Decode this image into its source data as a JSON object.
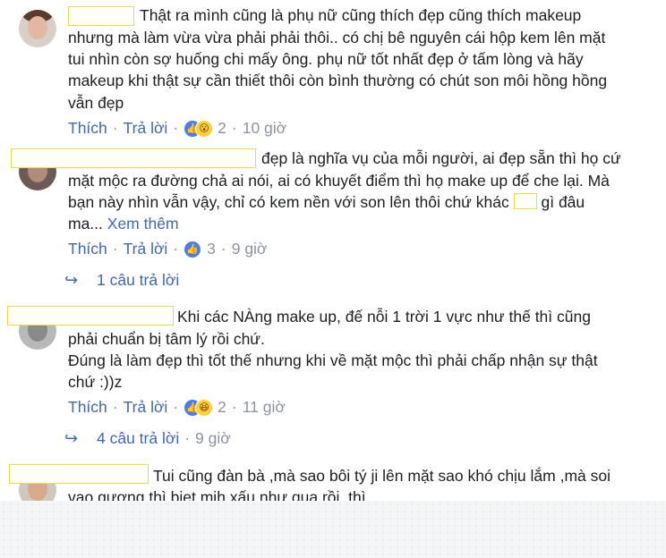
{
  "comments": [
    {
      "lines": [
        "Thật ra mình cũng là phụ nữ cũng thích đẹp cũng thích makeup",
        "nhưng mà làm vừa vừa phải phải thôi.. có chị bê nguyên cái hộp kem lên mặt",
        "tui nhìn còn sợ huống chi mấy ông. phụ nữ tốt nhất đẹp ở tấm lòng và hãy",
        "makeup khi thật sự cần thiết thôi còn bình thường có chút son môi hồng hồng",
        "vẫn đẹp"
      ],
      "like_label": "Thích",
      "reply_label": "Trả lời",
      "reaction_count": "2",
      "time": "10 giờ"
    },
    {
      "lines": [
        "đẹp là nghĩa vụ của mỗi người, ai đẹp sẵn thì họ cứ",
        "mặt mộc ra đường chả ai nói, ai có khuyết điểm thì họ make up để che lại. Mà",
        "bạn này nhìn vẫn vậy, chỉ có kem nền với son lên thôi chứ khác",
        "gì đâu",
        "ma...",
        "Xem thêm"
      ],
      "like_label": "Thích",
      "reply_label": "Trả lời",
      "reaction_count": "3",
      "time": "9 giờ",
      "replies": "1 câu trả lời"
    },
    {
      "lines": [
        "Khi các NÀng make up, đế nỗi 1 trời 1 vực như thế thì cũng",
        "phải chuẩn bị tâm lý rồi chứ.",
        "Đúng là làm đẹp thì tốt thế nhưng khi về mặt mộc thì phải chấp nhận sự thật",
        "chứ :))z"
      ],
      "like_label": "Thích",
      "reply_label": "Trả lời",
      "reaction_count": "2",
      "time": "11 giờ",
      "replies": "4 câu trả lời",
      "replies_time": "9 giờ"
    },
    {
      "lines": [
        "Tui cũng đàn bà ,mà sao bôi tý ji lên mặt sao khó chịu lắm ,mà soi",
        "vao gương thì biet mih xấu như qua rồi, thì ,"
      ]
    }
  ],
  "icons": {
    "like": "thumbs-up-icon",
    "wow": "wow-face-icon",
    "haha": "haha-face-icon",
    "reply": "reply-arrow-icon"
  },
  "colors": {
    "link": "#4267b2",
    "muted": "#8d949e",
    "text": "#1c1e21",
    "redaction_border": "#f0d84e"
  }
}
